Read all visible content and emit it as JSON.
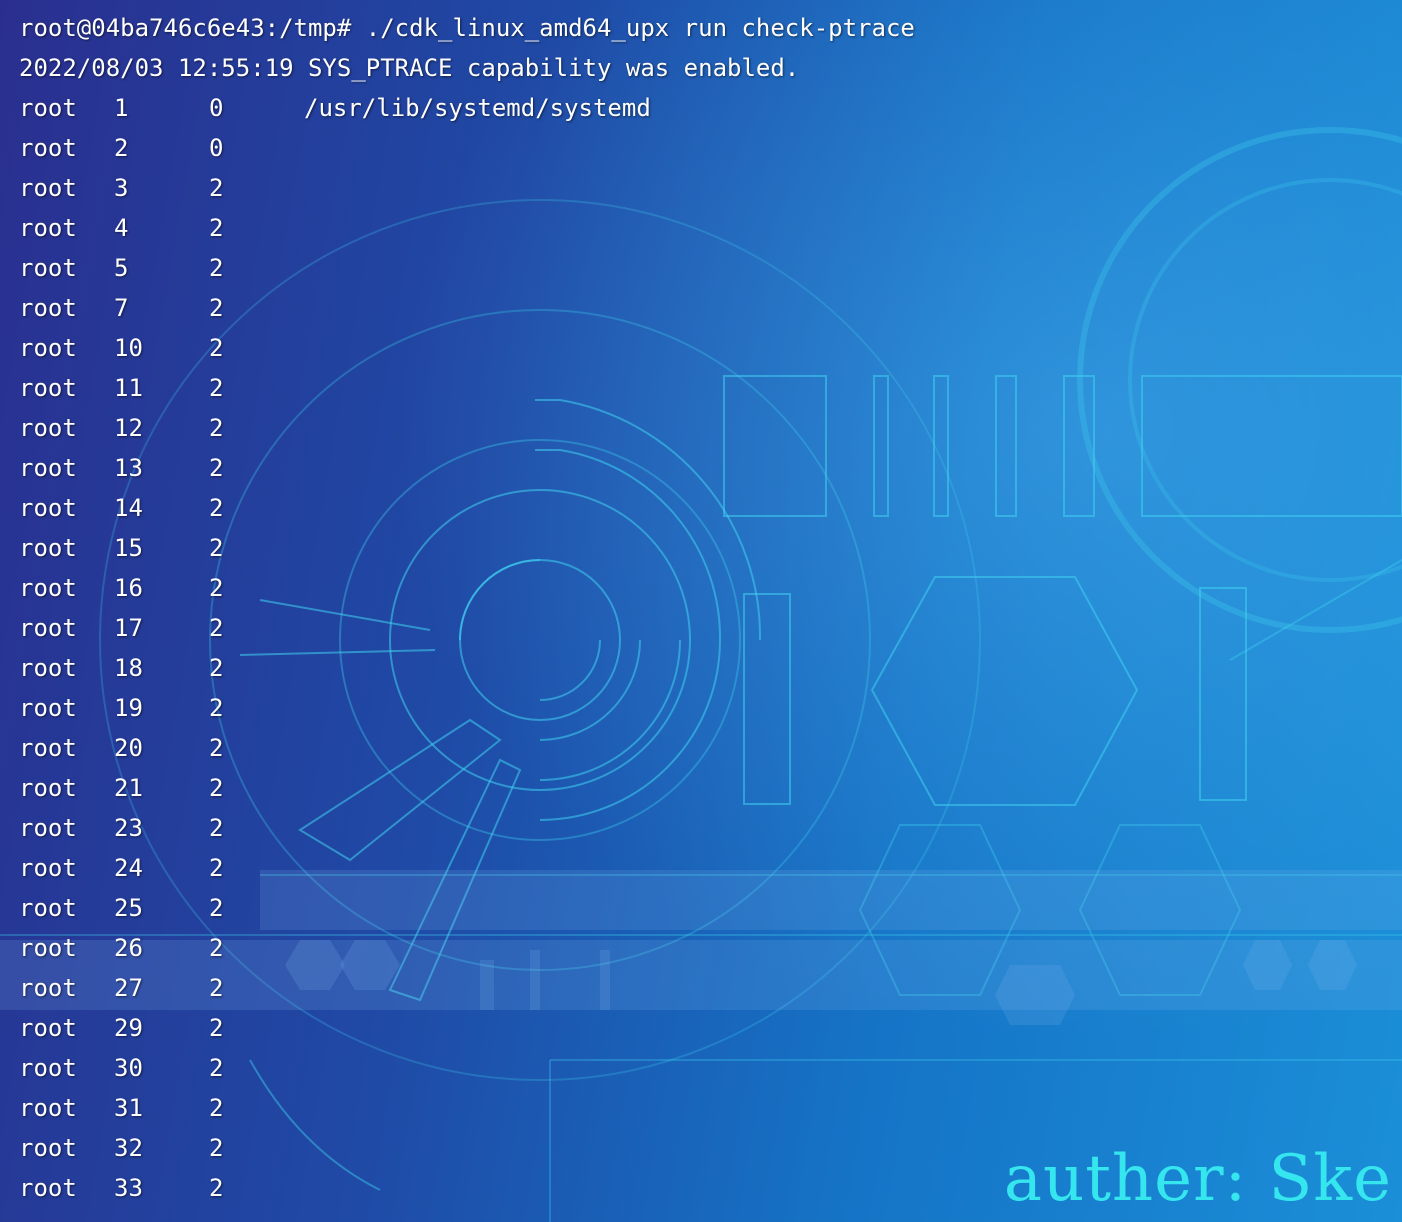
{
  "terminal": {
    "command_line": "root@04ba746c6e43:/tmp# ./cdk_linux_amd64_upx run check-ptrace",
    "status_line": "2022/08/03 12:55:19 SYS_PTRACE capability was enabled.",
    "processes": [
      {
        "user": "root",
        "pid": "1",
        "ppid": "0",
        "cmd": "/usr/lib/systemd/systemd"
      },
      {
        "user": "root",
        "pid": "2",
        "ppid": "0",
        "cmd": ""
      },
      {
        "user": "root",
        "pid": "3",
        "ppid": "2",
        "cmd": ""
      },
      {
        "user": "root",
        "pid": "4",
        "ppid": "2",
        "cmd": ""
      },
      {
        "user": "root",
        "pid": "5",
        "ppid": "2",
        "cmd": ""
      },
      {
        "user": "root",
        "pid": "7",
        "ppid": "2",
        "cmd": ""
      },
      {
        "user": "root",
        "pid": "10",
        "ppid": "2",
        "cmd": ""
      },
      {
        "user": "root",
        "pid": "11",
        "ppid": "2",
        "cmd": ""
      },
      {
        "user": "root",
        "pid": "12",
        "ppid": "2",
        "cmd": ""
      },
      {
        "user": "root",
        "pid": "13",
        "ppid": "2",
        "cmd": ""
      },
      {
        "user": "root",
        "pid": "14",
        "ppid": "2",
        "cmd": ""
      },
      {
        "user": "root",
        "pid": "15",
        "ppid": "2",
        "cmd": ""
      },
      {
        "user": "root",
        "pid": "16",
        "ppid": "2",
        "cmd": ""
      },
      {
        "user": "root",
        "pid": "17",
        "ppid": "2",
        "cmd": ""
      },
      {
        "user": "root",
        "pid": "18",
        "ppid": "2",
        "cmd": ""
      },
      {
        "user": "root",
        "pid": "19",
        "ppid": "2",
        "cmd": ""
      },
      {
        "user": "root",
        "pid": "20",
        "ppid": "2",
        "cmd": ""
      },
      {
        "user": "root",
        "pid": "21",
        "ppid": "2",
        "cmd": ""
      },
      {
        "user": "root",
        "pid": "23",
        "ppid": "2",
        "cmd": ""
      },
      {
        "user": "root",
        "pid": "24",
        "ppid": "2",
        "cmd": ""
      },
      {
        "user": "root",
        "pid": "25",
        "ppid": "2",
        "cmd": ""
      },
      {
        "user": "root",
        "pid": "26",
        "ppid": "2",
        "cmd": ""
      },
      {
        "user": "root",
        "pid": "27",
        "ppid": "2",
        "cmd": ""
      },
      {
        "user": "root",
        "pid": "29",
        "ppid": "2",
        "cmd": ""
      },
      {
        "user": "root",
        "pid": "30",
        "ppid": "2",
        "cmd": ""
      },
      {
        "user": "root",
        "pid": "31",
        "ppid": "2",
        "cmd": ""
      },
      {
        "user": "root",
        "pid": "32",
        "ppid": "2",
        "cmd": ""
      },
      {
        "user": "root",
        "pid": "33",
        "ppid": "2",
        "cmd": ""
      }
    ]
  },
  "watermark": "auther: Ske",
  "colors": {
    "text": "#ffffff",
    "watermark": "#35e6ef",
    "background_left": "#2a2f8f",
    "background_right": "#1b8fd8",
    "art_stroke": "#3fd0f0"
  }
}
